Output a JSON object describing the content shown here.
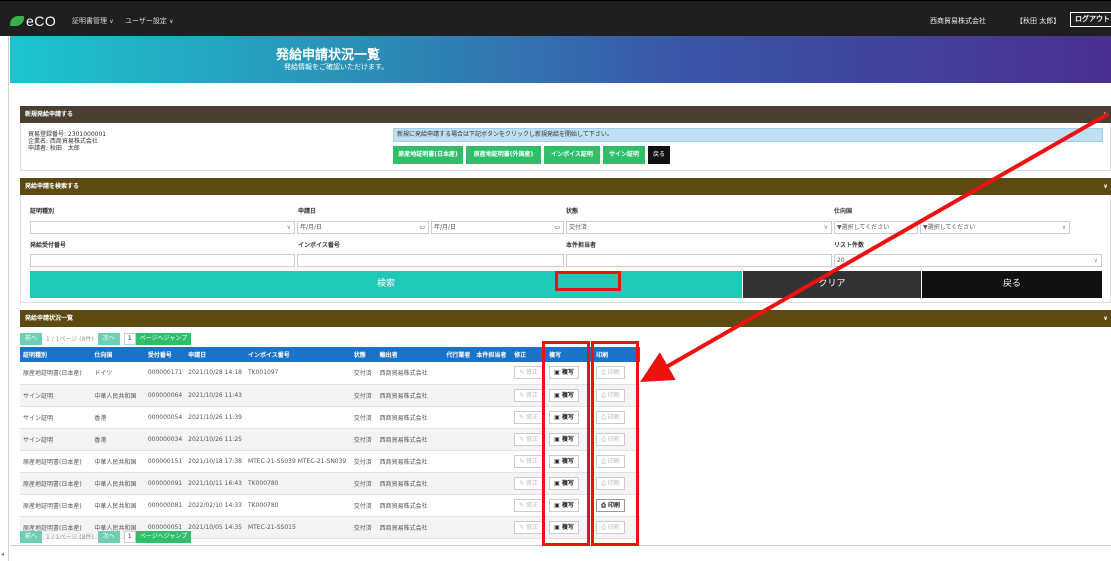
{
  "header": {
    "logo_text": "eCO",
    "menu": [
      {
        "label": "証明書管理"
      },
      {
        "label": "ユーザー設定"
      }
    ],
    "company": "西商貿易株式会社",
    "user": "【秋田 太郎】",
    "logout": "ログアウト"
  },
  "hero": {
    "title": "発給申請状況一覧",
    "subtitle": "発給情報をご確認いただけます。"
  },
  "new_request": {
    "heading": "新規発給申請する",
    "trade_no": "貿易登録番号: 2301000001",
    "company": "企業名: 西商貿易株式会社",
    "applicant": "申請者: 秋田　太郎",
    "info": "新規に発給申請する場合は下記ボタンをクリックし新規発給を開始して下さい。",
    "buttons": [
      "原産地証明書(日本産)",
      "原産地証明書(外国産)",
      "インボイス証明",
      "サイン証明"
    ],
    "back": "戻る"
  },
  "search": {
    "heading": "発給申請を検索する",
    "labels": {
      "cert_type": "証明種別",
      "apply_date": "申請日",
      "status": "状態",
      "destination": "仕向国",
      "receipt_no": "発給受付番号",
      "invoice_no": "インボイス番号",
      "owner": "本件担当者",
      "list_count": "リスト件数"
    },
    "date_placeholder": "年/月/日",
    "status_value": "交付済",
    "destination_value": "▼選択してください",
    "destination_value2": "▼選択してください",
    "list_count_value": "20",
    "search_btn": "検索",
    "clear_btn": "クリア",
    "back_btn": "戻る"
  },
  "list": {
    "heading": "発給申請状況一覧",
    "pager": {
      "prev": "前へ",
      "info": "1 / 1ページ (8件)",
      "next": "次へ",
      "page": "1",
      "jump": "ページへジャンプ"
    },
    "columns": [
      "証明種別",
      "仕向国",
      "受付番号",
      "申請日",
      "インボイス番号",
      "状態",
      "輸出者",
      "代行業者",
      "本件担当者",
      "修正",
      "複写",
      "印刷"
    ],
    "edit_label": "修正",
    "copy_label": "複写",
    "print_label": "印刷",
    "rows": [
      {
        "cert": "原産地証明書(日本産)",
        "dest": "ドイツ",
        "no": "000000171",
        "date": "2021/10/28 14:18",
        "invoice": "TK001097",
        "status": "交付済",
        "exporter": "西商貿易株式会社",
        "print_active": false
      },
      {
        "cert": "サイン証明",
        "dest": "中華人民共和国",
        "no": "000000064",
        "date": "2021/10/26 11:43",
        "invoice": "",
        "status": "交付済",
        "exporter": "西商貿易株式会社",
        "print_active": false
      },
      {
        "cert": "サイン証明",
        "dest": "香港",
        "no": "000000054",
        "date": "2021/10/26 11:39",
        "invoice": "",
        "status": "交付済",
        "exporter": "西商貿易株式会社",
        "print_active": false
      },
      {
        "cert": "サイン証明",
        "dest": "香港",
        "no": "000000034",
        "date": "2021/10/26 11:25",
        "invoice": "",
        "status": "交付済",
        "exporter": "西商貿易株式会社",
        "print_active": false
      },
      {
        "cert": "原産地証明書(日本産)",
        "dest": "中華人民共和国",
        "no": "000000151",
        "date": "2021/10/18 17:38",
        "invoice": "MTEC-21-SS039 MTEC-21-SN039",
        "status": "交付済",
        "exporter": "西商貿易株式会社",
        "print_active": false
      },
      {
        "cert": "原産地証明書(日本産)",
        "dest": "中華人民共和国",
        "no": "000000091",
        "date": "2021/10/11 16:43",
        "invoice": "TK000780",
        "status": "交付済",
        "exporter": "西商貿易株式会社",
        "print_active": false
      },
      {
        "cert": "原産地証明書(日本産)",
        "dest": "中華人民共和国",
        "no": "000000081",
        "date": "2022/02/10 14:33",
        "invoice": "TK000780",
        "status": "交付済",
        "exporter": "西商貿易株式会社",
        "print_active": true
      },
      {
        "cert": "原産地証明書(日本産)",
        "dest": "中華人民共和国",
        "no": "000000051",
        "date": "2021/10/05 14:35",
        "invoice": "MTEC-21-SS015",
        "status": "交付済",
        "exporter": "西商貿易株式会社",
        "print_active": false
      }
    ]
  },
  "colors": {
    "annotation": "#ee1111",
    "table_header": "#1a73c9",
    "green_button": "#2fbf6b",
    "search_button": "#1fc9b5"
  }
}
